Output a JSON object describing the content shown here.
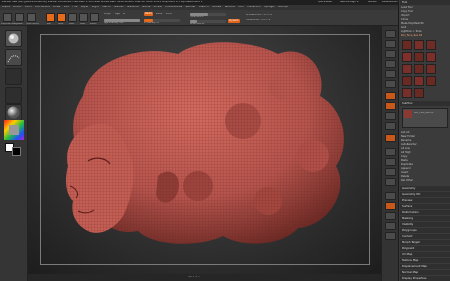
{
  "app": {
    "title_line": "ZBrush 4R6 (64) [JAMES-DESKTOP]  ZBrush Document  Free Mem 1.3+1.2GB  Active Mem 3446  Scratch Disk 49  Timer 0.011  PolyCount 1.3 Mp  MeshCount 1",
    "quicksave": "QuickSave",
    "seethrough": "See-through 0",
    "menus": "Menus",
    "default_script": "DefaultZScript"
  },
  "menubar": [
    "Alpha",
    "Brush",
    "Color",
    "Document",
    "Draw",
    "Edit",
    "File",
    "Layer",
    "Light",
    "Macro",
    "Marker",
    "Material",
    "Movie",
    "Picker",
    "Preferences",
    "Render",
    "Stencil",
    "Stroke",
    "Texture",
    "Tool",
    "Transform",
    "Zplugin",
    "Zscript"
  ],
  "toolbar": {
    "projection_master": "Projection Master",
    "lightbox": "LightBox",
    "quick_sketch": "Quick Sketch",
    "edit": "Edit",
    "draw": "Draw",
    "move": "Move",
    "scale": "Scale",
    "rotate": "Rotate",
    "mrgb": "Mrgb",
    "rgb": "Rgb",
    "m": "M",
    "zadd": "Zadd",
    "zsub": "Zsub",
    "zcut": "Zcut",
    "rgb_intensity": "Rgb Intensity 100",
    "z_intensity": "Z Intensity 25",
    "focal_shift": "Focal Shift 0",
    "draw_size": "Draw Size 64",
    "dynamic": "Dynamic",
    "active_points": "ActivePoints: 753,776",
    "total_points": "TotalPoints: 753,776"
  },
  "tray": {
    "tool_label": "Tool",
    "rows": [
      "Load Tool",
      "Save As",
      "Copy Tool",
      "Paste Tool",
      "Import",
      "Export",
      "Clone",
      "Make PolyMesh3D",
      "GoZ",
      "All",
      "Visible",
      "R"
    ],
    "lightbox_tools": "Lightbox > Tools",
    "current_tool": "Kiki_Face_Res 48",
    "subtool": "SubTool",
    "geometry": "Geometry",
    "layers": "Layers",
    "fibermesh": "FiberMesh",
    "geometry_hd": "Geometry HD",
    "preview": "Preview",
    "surface": "Surface",
    "deformation": "Deformation",
    "masking": "Masking",
    "visibility": "Visibility",
    "polygroups": "Polygroups",
    "contact": "Contact",
    "morph_target": "Morph Target",
    "polypaint": "Polypaint",
    "uv_map": "UV Map",
    "texture_map": "Texture Map",
    "displacement_map": "Displacement Map",
    "normal_map": "Normal Map",
    "vector_displacement": "Vector Displacement Map",
    "display_properties": "Display Properties",
    "unified_skin": "Unified Skin",
    "initialize": "Initialize",
    "import": "Import",
    "export": "Export",
    "list_all": "List All",
    "new_folder": "New Folder",
    "rename": "Rename",
    "autoreorder": "AutoReorder",
    "all_low": "All Low",
    "all_high": "All High",
    "copy": "Copy",
    "paste": "Paste",
    "duplicate": "Duplicate",
    "append": "Append",
    "insert": "Insert",
    "del_other": "Del Other",
    "delete": "Delete"
  },
  "colors": {
    "accent": "#e66a1a",
    "mesh": "#b5544d",
    "background": "#2b2b2b",
    "primary_swatch": "#ffffff",
    "secondary_swatch": "#000000"
  },
  "status_bottom": "Set 1 of 5"
}
